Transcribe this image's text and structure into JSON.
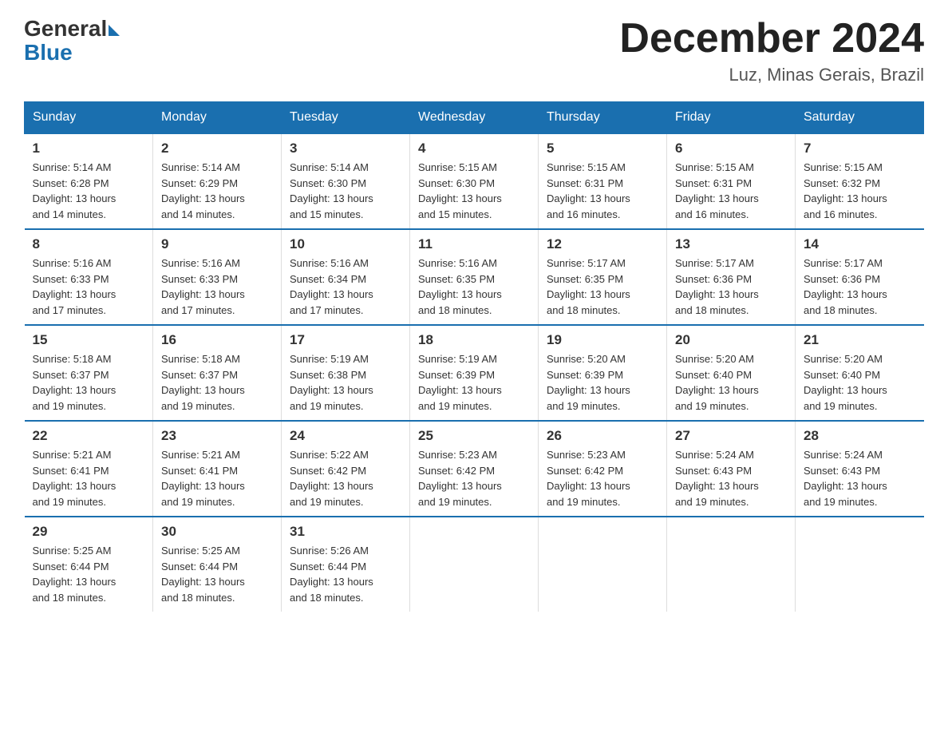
{
  "header": {
    "logo_general": "General",
    "logo_blue": "Blue",
    "month_title": "December 2024",
    "location": "Luz, Minas Gerais, Brazil"
  },
  "days_of_week": [
    "Sunday",
    "Monday",
    "Tuesday",
    "Wednesday",
    "Thursday",
    "Friday",
    "Saturday"
  ],
  "weeks": [
    [
      {
        "day": "1",
        "sunrise": "5:14 AM",
        "sunset": "6:28 PM",
        "daylight": "13 hours and 14 minutes."
      },
      {
        "day": "2",
        "sunrise": "5:14 AM",
        "sunset": "6:29 PM",
        "daylight": "13 hours and 14 minutes."
      },
      {
        "day": "3",
        "sunrise": "5:14 AM",
        "sunset": "6:30 PM",
        "daylight": "13 hours and 15 minutes."
      },
      {
        "day": "4",
        "sunrise": "5:15 AM",
        "sunset": "6:30 PM",
        "daylight": "13 hours and 15 minutes."
      },
      {
        "day": "5",
        "sunrise": "5:15 AM",
        "sunset": "6:31 PM",
        "daylight": "13 hours and 16 minutes."
      },
      {
        "day": "6",
        "sunrise": "5:15 AM",
        "sunset": "6:31 PM",
        "daylight": "13 hours and 16 minutes."
      },
      {
        "day": "7",
        "sunrise": "5:15 AM",
        "sunset": "6:32 PM",
        "daylight": "13 hours and 16 minutes."
      }
    ],
    [
      {
        "day": "8",
        "sunrise": "5:16 AM",
        "sunset": "6:33 PM",
        "daylight": "13 hours and 17 minutes."
      },
      {
        "day": "9",
        "sunrise": "5:16 AM",
        "sunset": "6:33 PM",
        "daylight": "13 hours and 17 minutes."
      },
      {
        "day": "10",
        "sunrise": "5:16 AM",
        "sunset": "6:34 PM",
        "daylight": "13 hours and 17 minutes."
      },
      {
        "day": "11",
        "sunrise": "5:16 AM",
        "sunset": "6:35 PM",
        "daylight": "13 hours and 18 minutes."
      },
      {
        "day": "12",
        "sunrise": "5:17 AM",
        "sunset": "6:35 PM",
        "daylight": "13 hours and 18 minutes."
      },
      {
        "day": "13",
        "sunrise": "5:17 AM",
        "sunset": "6:36 PM",
        "daylight": "13 hours and 18 minutes."
      },
      {
        "day": "14",
        "sunrise": "5:17 AM",
        "sunset": "6:36 PM",
        "daylight": "13 hours and 18 minutes."
      }
    ],
    [
      {
        "day": "15",
        "sunrise": "5:18 AM",
        "sunset": "6:37 PM",
        "daylight": "13 hours and 19 minutes."
      },
      {
        "day": "16",
        "sunrise": "5:18 AM",
        "sunset": "6:37 PM",
        "daylight": "13 hours and 19 minutes."
      },
      {
        "day": "17",
        "sunrise": "5:19 AM",
        "sunset": "6:38 PM",
        "daylight": "13 hours and 19 minutes."
      },
      {
        "day": "18",
        "sunrise": "5:19 AM",
        "sunset": "6:39 PM",
        "daylight": "13 hours and 19 minutes."
      },
      {
        "day": "19",
        "sunrise": "5:20 AM",
        "sunset": "6:39 PM",
        "daylight": "13 hours and 19 minutes."
      },
      {
        "day": "20",
        "sunrise": "5:20 AM",
        "sunset": "6:40 PM",
        "daylight": "13 hours and 19 minutes."
      },
      {
        "day": "21",
        "sunrise": "5:20 AM",
        "sunset": "6:40 PM",
        "daylight": "13 hours and 19 minutes."
      }
    ],
    [
      {
        "day": "22",
        "sunrise": "5:21 AM",
        "sunset": "6:41 PM",
        "daylight": "13 hours and 19 minutes."
      },
      {
        "day": "23",
        "sunrise": "5:21 AM",
        "sunset": "6:41 PM",
        "daylight": "13 hours and 19 minutes."
      },
      {
        "day": "24",
        "sunrise": "5:22 AM",
        "sunset": "6:42 PM",
        "daylight": "13 hours and 19 minutes."
      },
      {
        "day": "25",
        "sunrise": "5:23 AM",
        "sunset": "6:42 PM",
        "daylight": "13 hours and 19 minutes."
      },
      {
        "day": "26",
        "sunrise": "5:23 AM",
        "sunset": "6:42 PM",
        "daylight": "13 hours and 19 minutes."
      },
      {
        "day": "27",
        "sunrise": "5:24 AM",
        "sunset": "6:43 PM",
        "daylight": "13 hours and 19 minutes."
      },
      {
        "day": "28",
        "sunrise": "5:24 AM",
        "sunset": "6:43 PM",
        "daylight": "13 hours and 19 minutes."
      }
    ],
    [
      {
        "day": "29",
        "sunrise": "5:25 AM",
        "sunset": "6:44 PM",
        "daylight": "13 hours and 18 minutes."
      },
      {
        "day": "30",
        "sunrise": "5:25 AM",
        "sunset": "6:44 PM",
        "daylight": "13 hours and 18 minutes."
      },
      {
        "day": "31",
        "sunrise": "5:26 AM",
        "sunset": "6:44 PM",
        "daylight": "13 hours and 18 minutes."
      },
      null,
      null,
      null,
      null
    ]
  ],
  "labels": {
    "sunrise": "Sunrise:",
    "sunset": "Sunset:",
    "daylight": "Daylight:"
  }
}
